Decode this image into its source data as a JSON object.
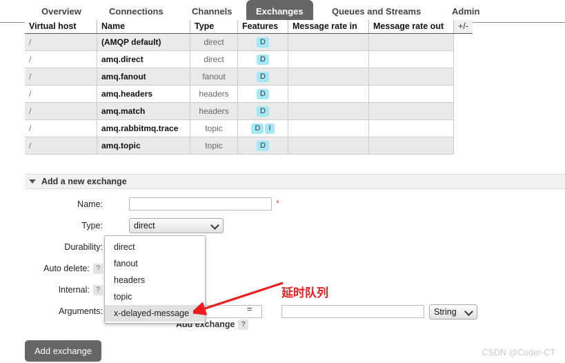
{
  "nav": {
    "tabs": [
      {
        "label": "Overview",
        "active": false
      },
      {
        "label": "Connections",
        "active": false
      },
      {
        "label": "Channels",
        "active": false
      },
      {
        "label": "Exchanges",
        "active": true
      },
      {
        "label": "Queues and Streams",
        "active": false
      },
      {
        "label": "Admin",
        "active": false
      }
    ]
  },
  "exchanges_table": {
    "columns": [
      "Virtual host",
      "Name",
      "Type",
      "Features",
      "Message rate in",
      "Message rate out"
    ],
    "column_toggle_label": "+/-",
    "rows": [
      {
        "vhost": "/",
        "name": "(AMQP default)",
        "type": "direct",
        "features": [
          "D"
        ],
        "rate_in": "",
        "rate_out": ""
      },
      {
        "vhost": "/",
        "name": "amq.direct",
        "type": "direct",
        "features": [
          "D"
        ],
        "rate_in": "",
        "rate_out": ""
      },
      {
        "vhost": "/",
        "name": "amq.fanout",
        "type": "fanout",
        "features": [
          "D"
        ],
        "rate_in": "",
        "rate_out": ""
      },
      {
        "vhost": "/",
        "name": "amq.headers",
        "type": "headers",
        "features": [
          "D"
        ],
        "rate_in": "",
        "rate_out": ""
      },
      {
        "vhost": "/",
        "name": "amq.match",
        "type": "headers",
        "features": [
          "D"
        ],
        "rate_in": "",
        "rate_out": ""
      },
      {
        "vhost": "/",
        "name": "amq.rabbitmq.trace",
        "type": "topic",
        "features": [
          "D",
          "I"
        ],
        "rate_in": "",
        "rate_out": ""
      },
      {
        "vhost": "/",
        "name": "amq.topic",
        "type": "topic",
        "features": [
          "D"
        ],
        "rate_in": "",
        "rate_out": ""
      }
    ]
  },
  "add_exchange": {
    "section_title": "Add a new exchange",
    "name_label": "Name:",
    "name_value": "",
    "name_required_marker": "*",
    "type_label": "Type:",
    "type_value": "direct",
    "type_options": [
      "direct",
      "fanout",
      "headers",
      "topic",
      "x-delayed-message"
    ],
    "type_highlighted_option": "x-delayed-message",
    "durability_label": "Durability:",
    "auto_delete_label": "Auto delete:",
    "auto_delete_help": "?",
    "internal_label": "Internal:",
    "internal_help": "?",
    "arguments_label": "Arguments:",
    "arg_key_value": "",
    "arg_equals": "=",
    "arg_value_value": "",
    "arg_type_value": "String",
    "add_arg_link": "Add exchange",
    "add_arg_help": "?",
    "submit_label": "Add exchange"
  },
  "annotation": {
    "text": "延时队列",
    "color": "#ee1c1c"
  },
  "watermark": {
    "text": "CSDN @Coder-CT"
  },
  "colors": {
    "active_tab_bg": "#666666",
    "feature_badge_bg": "#a4e8f7",
    "required_star": "#e05a4a",
    "annotation_red": "#ee1c1c"
  }
}
